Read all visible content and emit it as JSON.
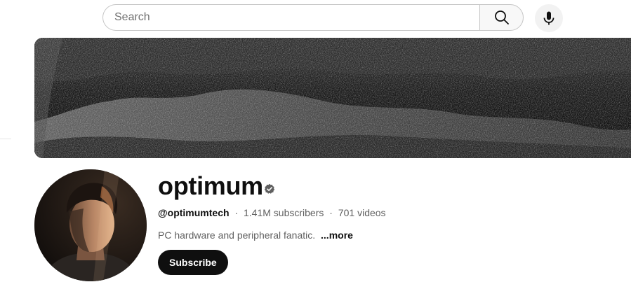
{
  "search": {
    "placeholder": "Search",
    "value": "",
    "search_button_icon": "search-icon",
    "mic_button_icon": "microphone-icon"
  },
  "banner": {
    "image": "dark ink-wash texture banner"
  },
  "channel": {
    "name": "optimum",
    "verified_icon": "verified-check-icon",
    "handle": "@optimumtech",
    "separator": "·",
    "subscribers": "1.41M subscribers",
    "videos": "701 videos",
    "description": "PC hardware and peripheral fanatic.",
    "more_label": "...more",
    "subscribe_label": "Subscribe",
    "avatar_image": "channel avatar portrait"
  },
  "colors": {
    "text_primary": "#0f0f0f",
    "text_secondary": "#606060",
    "subscribe_bg": "#0f0f0f",
    "subscribe_text": "#ffffff",
    "search_border": "#c6c6c6"
  }
}
